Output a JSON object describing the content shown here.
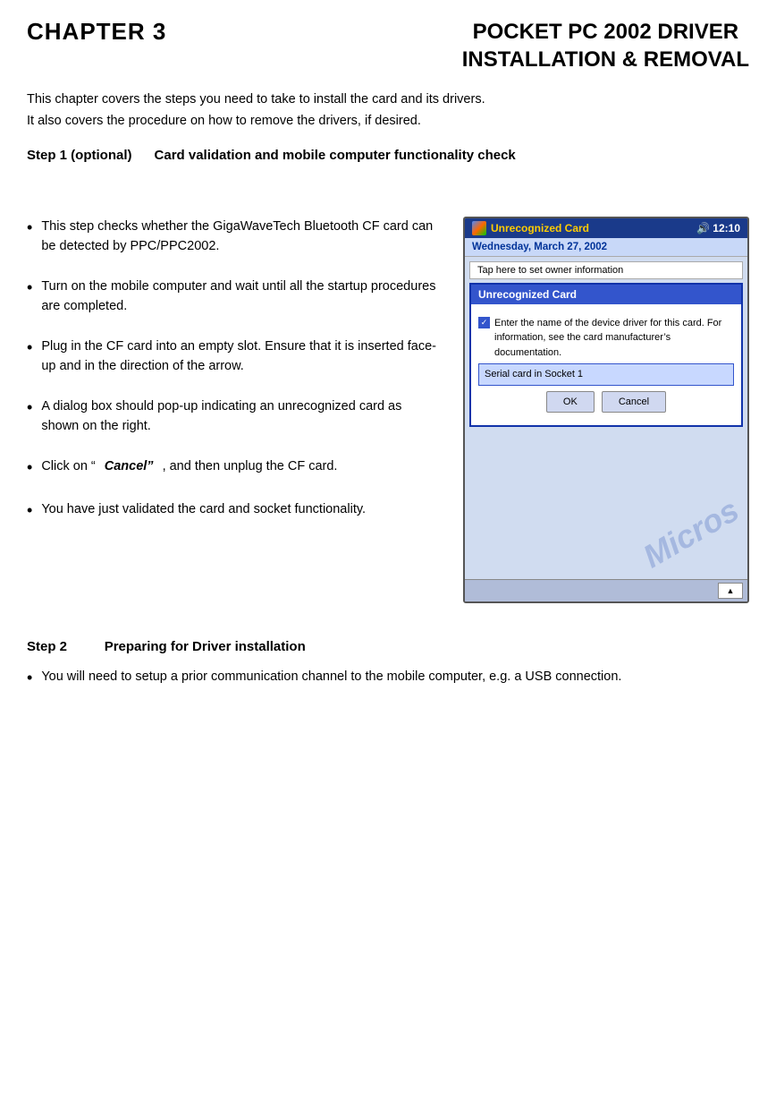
{
  "header": {
    "chapter": "CHAPTER 3",
    "title_line1": "POCKET PC 2002 DRIVER",
    "title_line2": "INSTALLATION & REMOVAL"
  },
  "intro": {
    "line1": "This chapter covers the steps you need to take to install the card and its drivers.",
    "line2": "It also covers the procedure on how to remove the drivers, if desired."
  },
  "step1": {
    "label": "Step 1 (optional)",
    "description": "Card validation and mobile computer functionality check"
  },
  "bullets": [
    {
      "id": 1,
      "text": "This step checks whether the GigaWaveTech Bluetooth CF card can be detected by PPC/PPC2002."
    },
    {
      "id": 2,
      "text": "Turn on the mobile computer and wait until all the startup procedures are completed."
    },
    {
      "id": 3,
      "text": "Plug in the CF card into an empty slot.  Ensure that it is inserted face-up and in the direction of the arrow."
    },
    {
      "id": 4,
      "text": "A dialog box should pop-up indicating an unrecognized card as shown on the right."
    },
    {
      "id": 5,
      "text_prefix": "Click on “",
      "text_bold_italic": "Cancel”",
      "text_suffix": ", and then unplug the CF card."
    },
    {
      "id": 6,
      "text": "You have just validated the card and socket functionality."
    }
  ],
  "phone": {
    "taskbar_title": "Unrecognized Card",
    "taskbar_time": "12:10",
    "date": "Wednesday, March 27, 2002",
    "list_item": "Tap here to set owner information",
    "dialog_title": "Unrecognized Card",
    "dialog_body": "Enter the name of the device driver for this card. For information, see the card manufacturer’s documentation.",
    "input_value": "Serial card in Socket 1",
    "btn_ok": "OK",
    "btn_cancel": "Cancel",
    "watermark": "Micros"
  },
  "step2": {
    "label": "Step 2",
    "description": "Preparing for Driver installation"
  },
  "step2_bullets": [
    {
      "id": 1,
      "text": "You will need to setup a prior communication channel to the mobile computer, e.g. a USB connection."
    }
  ]
}
